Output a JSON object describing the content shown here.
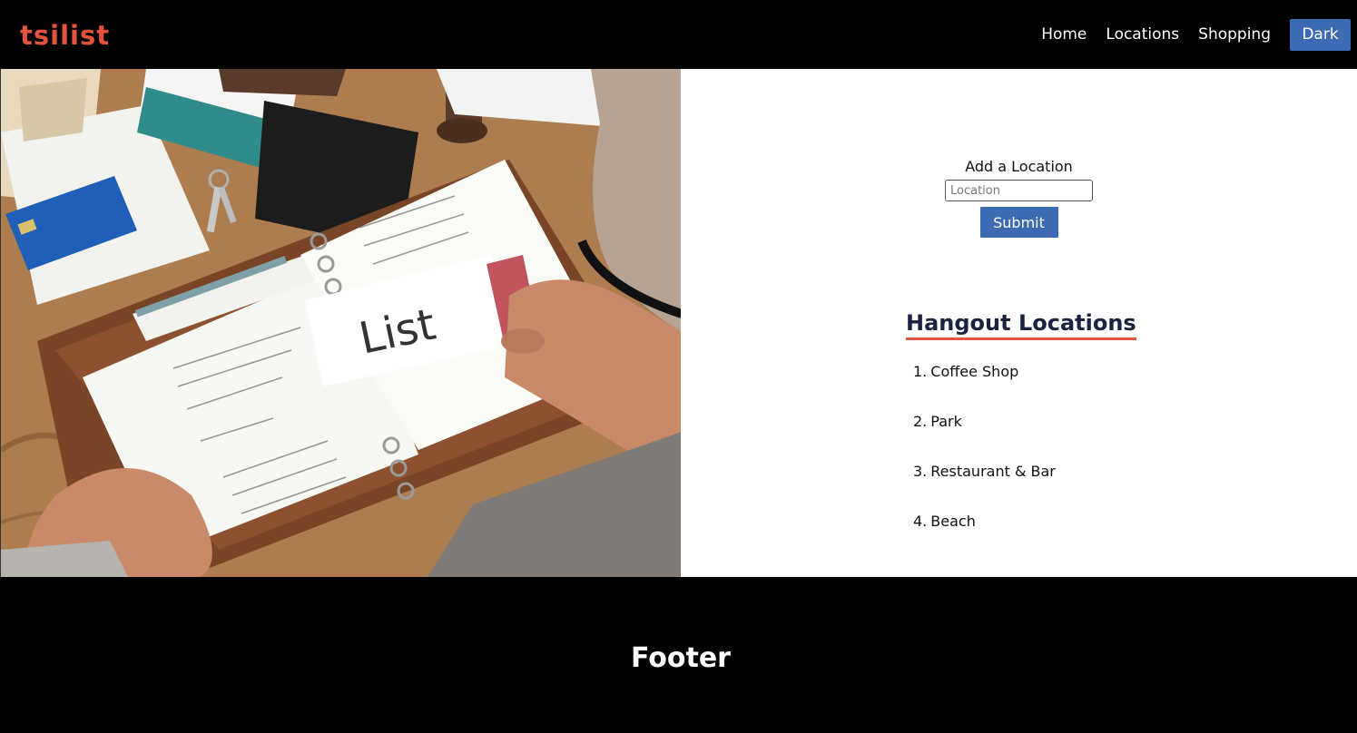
{
  "header": {
    "logo": "tsilist",
    "nav": [
      "Home",
      "Locations",
      "Shopping"
    ],
    "theme_button": "Dark"
  },
  "hero_image": {
    "card_text": "List"
  },
  "form": {
    "label": "Add a Location",
    "input_placeholder": "Location",
    "submit_label": "Submit"
  },
  "list": {
    "title": "Hangout Locations",
    "items": [
      {
        "num": "1.",
        "label": "Coffee Shop"
      },
      {
        "num": "2.",
        "label": "Park"
      },
      {
        "num": "3.",
        "label": "Restaurant & Bar"
      },
      {
        "num": "4.",
        "label": "Beach"
      }
    ]
  },
  "footer": {
    "text": "Footer"
  },
  "colors": {
    "accent": "#e5533d",
    "button": "#3d6bb3",
    "title": "#1a2340"
  }
}
